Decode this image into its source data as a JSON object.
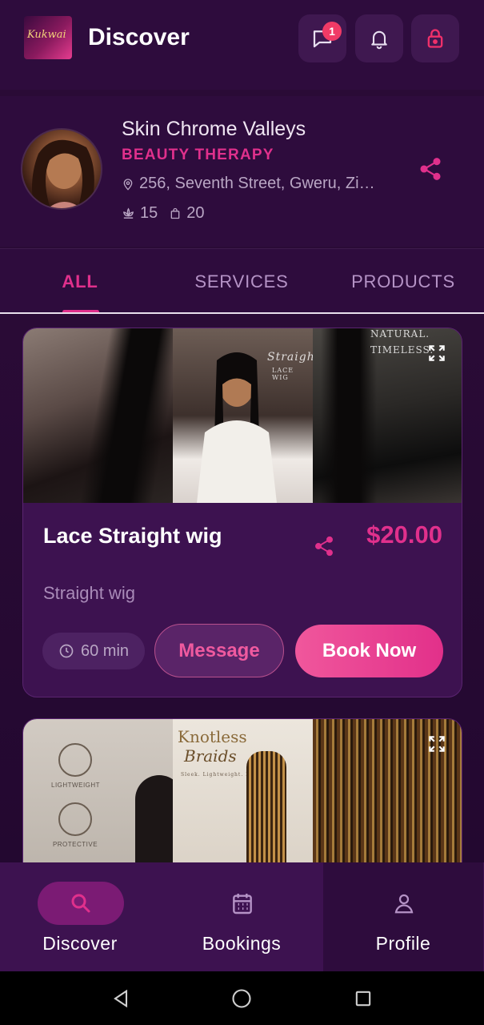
{
  "header": {
    "logo_text": "Kukwai",
    "title": "Discover",
    "chat_badge": "1"
  },
  "business": {
    "name": "Skin Chrome Valleys",
    "category": "BEAUTY THERAPY",
    "address": "256, Seventh Street, Gweru, Zi…",
    "services_count": "15",
    "products_count": "20"
  },
  "tabs": [
    {
      "label": "ALL",
      "active": true
    },
    {
      "label": "SERVICES",
      "active": false
    },
    {
      "label": "PRODUCTS",
      "active": false
    }
  ],
  "cards": [
    {
      "title": "Lace Straight wig",
      "price": "$20.00",
      "description": "Straight wig",
      "duration": "60 min",
      "message_label": "Message",
      "book_label": "Book Now",
      "image_texts": {
        "overlay_1": "NATURAL.",
        "overlay_2": "TIMELESS.",
        "poster_title": "Straight",
        "poster_sub": "LACE WIG"
      }
    },
    {
      "image_texts": {
        "feature_1": "LIGHTWEIGHT",
        "feature_2": "PROTECTIVE",
        "poster_title": "Knotless",
        "poster_sub": "Braids",
        "poster_tagline": "Sleek. Lightweight. Protective."
      }
    }
  ],
  "bottom_nav": [
    {
      "label": "Discover",
      "icon": "search-icon",
      "active": true
    },
    {
      "label": "Bookings",
      "icon": "calendar-icon",
      "active": false
    },
    {
      "label": "Profile",
      "icon": "person-icon",
      "active": false
    }
  ],
  "colors": {
    "accent": "#e0308c",
    "background": "#2a0b36",
    "card": "#3d1250"
  }
}
